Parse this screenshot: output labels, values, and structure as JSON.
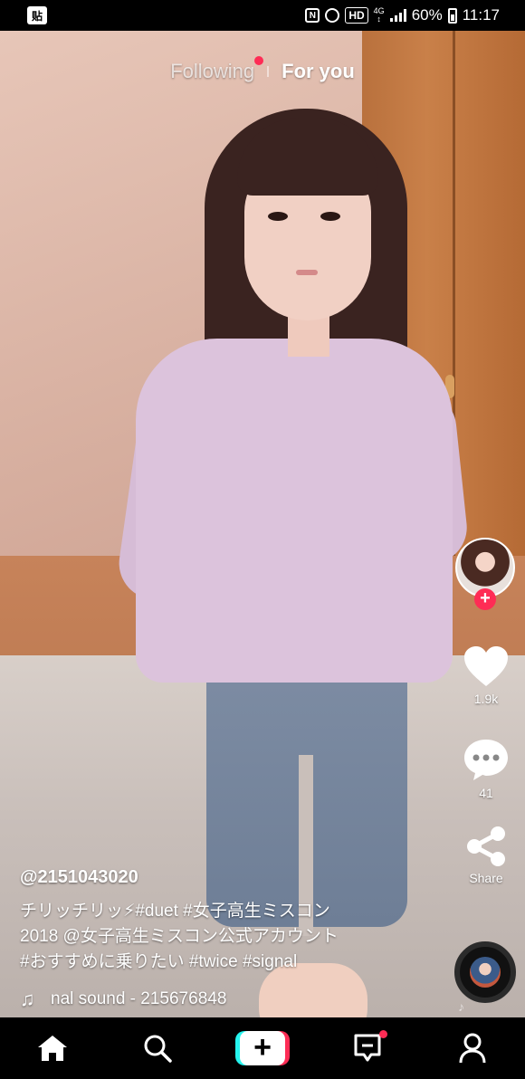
{
  "status_bar": {
    "notif_app": "贴",
    "nfc": "N",
    "hd": "HD",
    "network": "4G",
    "battery": "60%",
    "time": "11:17"
  },
  "tabs": {
    "following": "Following",
    "for_you": "For you"
  },
  "actions": {
    "likes": "1.9k",
    "comments": "41",
    "share": "Share"
  },
  "caption": {
    "username": "@2151043020",
    "line1": "チリッチリッ⚡#duet #女子高生ミスコン",
    "line2": "2018 @女子高生ミスコン公式アカウント",
    "line3": "#おすすめに乗りたい #twice #signal",
    "sound": "nal sound - 215676848"
  },
  "colors": {
    "accent": "#fe2c55",
    "accent2": "#25f4ee"
  },
  "icons": [
    "home-icon",
    "search-icon",
    "create-icon",
    "inbox-icon",
    "profile-icon",
    "heart-icon",
    "comment-icon",
    "share-icon",
    "music-note-icon"
  ]
}
